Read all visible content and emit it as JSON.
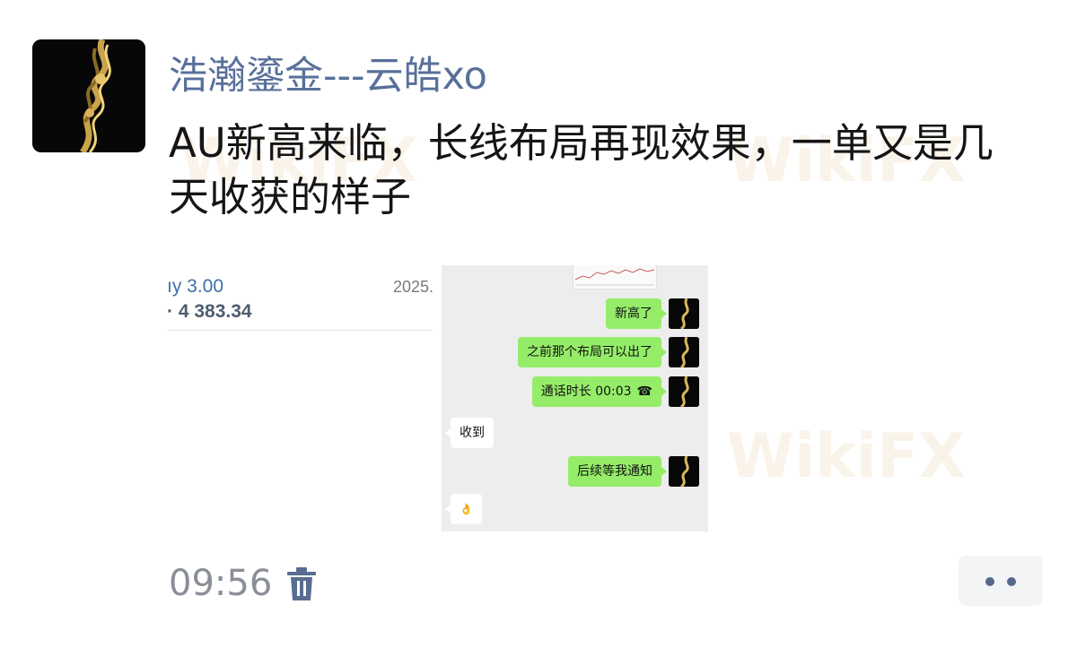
{
  "post": {
    "username": "浩瀚鎏金---云皓xo",
    "text": "AU新高来临，长线布局再现效果，一单又是几天收获的样子",
    "time": "09:56"
  },
  "image_left": {
    "line1": "ıy 3.00",
    "line2": "· 4 383.34",
    "date": "2025.¹"
  },
  "image_chat": {
    "messages": [
      {
        "side": "me",
        "text": "新高了"
      },
      {
        "side": "me",
        "text": "之前那个布局可以出了"
      },
      {
        "side": "me",
        "text": "通话时长 00:03"
      },
      {
        "side": "them",
        "text": "收到"
      },
      {
        "side": "me",
        "text": "后续等我通知"
      },
      {
        "side": "them",
        "text": "👌"
      }
    ]
  },
  "watermark": {
    "text": "WikiFX"
  },
  "icons": {
    "delete": "trash-icon",
    "more": "more-icon",
    "call": "phone-icon"
  },
  "colors": {
    "username": "#58709a",
    "bubble_me": "#95ec69",
    "bubble_them": "#ffffff",
    "chat_bg": "#ededed"
  }
}
